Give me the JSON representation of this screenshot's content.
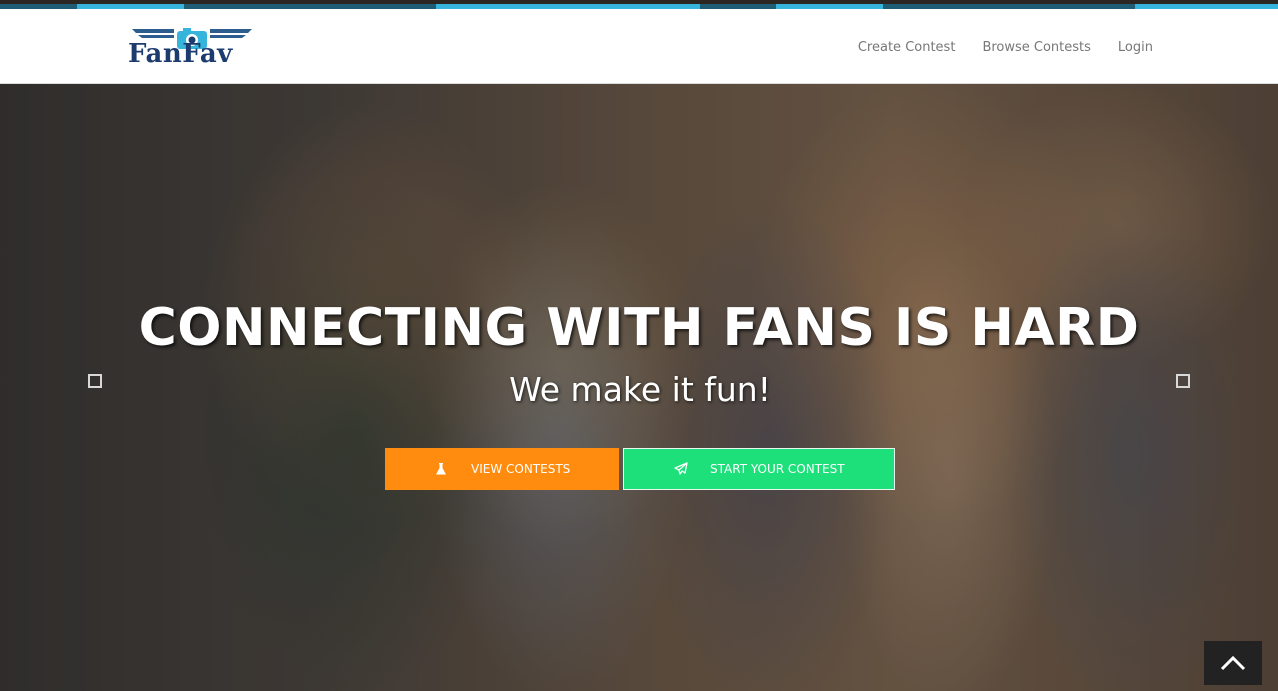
{
  "brand": {
    "logo_text": "FanFav"
  },
  "nav": {
    "items": [
      "Create Contest",
      "Browse Contests",
      "Login"
    ]
  },
  "hero": {
    "title": "CONNECTING WITH FANS IS HARD",
    "subtitle": "We make it fun!",
    "buttons": {
      "view_contests": "VIEW CONTESTS",
      "start_contest": "START YOUR CONTEST"
    }
  },
  "colors": {
    "accent_orange": "#ff8c0e",
    "accent_green": "#1de07a",
    "brand_navy": "#1c3b6e",
    "strip_dark": "#1e5d73",
    "strip_light": "#36b4dc"
  },
  "icons": {
    "view_contests": "flask-icon",
    "start_contest": "paper-plane-icon",
    "scroll_top": "chevron-up-icon",
    "slider_prev": "square-icon",
    "slider_next": "square-icon"
  }
}
